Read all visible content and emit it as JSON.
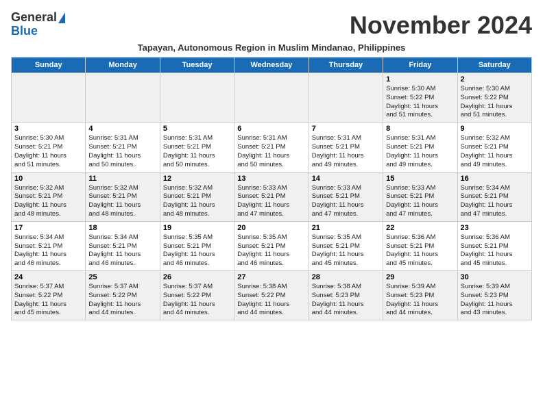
{
  "header": {
    "logo_general": "General",
    "logo_blue": "Blue",
    "month_title": "November 2024",
    "subtitle": "Tapayan, Autonomous Region in Muslim Mindanao, Philippines"
  },
  "weekdays": [
    "Sunday",
    "Monday",
    "Tuesday",
    "Wednesday",
    "Thursday",
    "Friday",
    "Saturday"
  ],
  "weeks": [
    [
      {
        "day": "",
        "info": ""
      },
      {
        "day": "",
        "info": ""
      },
      {
        "day": "",
        "info": ""
      },
      {
        "day": "",
        "info": ""
      },
      {
        "day": "",
        "info": ""
      },
      {
        "day": "1",
        "info": "Sunrise: 5:30 AM\nSunset: 5:22 PM\nDaylight: 11 hours\nand 51 minutes."
      },
      {
        "day": "2",
        "info": "Sunrise: 5:30 AM\nSunset: 5:22 PM\nDaylight: 11 hours\nand 51 minutes."
      }
    ],
    [
      {
        "day": "3",
        "info": "Sunrise: 5:30 AM\nSunset: 5:21 PM\nDaylight: 11 hours\nand 51 minutes."
      },
      {
        "day": "4",
        "info": "Sunrise: 5:31 AM\nSunset: 5:21 PM\nDaylight: 11 hours\nand 50 minutes."
      },
      {
        "day": "5",
        "info": "Sunrise: 5:31 AM\nSunset: 5:21 PM\nDaylight: 11 hours\nand 50 minutes."
      },
      {
        "day": "6",
        "info": "Sunrise: 5:31 AM\nSunset: 5:21 PM\nDaylight: 11 hours\nand 50 minutes."
      },
      {
        "day": "7",
        "info": "Sunrise: 5:31 AM\nSunset: 5:21 PM\nDaylight: 11 hours\nand 49 minutes."
      },
      {
        "day": "8",
        "info": "Sunrise: 5:31 AM\nSunset: 5:21 PM\nDaylight: 11 hours\nand 49 minutes."
      },
      {
        "day": "9",
        "info": "Sunrise: 5:32 AM\nSunset: 5:21 PM\nDaylight: 11 hours\nand 49 minutes."
      }
    ],
    [
      {
        "day": "10",
        "info": "Sunrise: 5:32 AM\nSunset: 5:21 PM\nDaylight: 11 hours\nand 48 minutes."
      },
      {
        "day": "11",
        "info": "Sunrise: 5:32 AM\nSunset: 5:21 PM\nDaylight: 11 hours\nand 48 minutes."
      },
      {
        "day": "12",
        "info": "Sunrise: 5:32 AM\nSunset: 5:21 PM\nDaylight: 11 hours\nand 48 minutes."
      },
      {
        "day": "13",
        "info": "Sunrise: 5:33 AM\nSunset: 5:21 PM\nDaylight: 11 hours\nand 47 minutes."
      },
      {
        "day": "14",
        "info": "Sunrise: 5:33 AM\nSunset: 5:21 PM\nDaylight: 11 hours\nand 47 minutes."
      },
      {
        "day": "15",
        "info": "Sunrise: 5:33 AM\nSunset: 5:21 PM\nDaylight: 11 hours\nand 47 minutes."
      },
      {
        "day": "16",
        "info": "Sunrise: 5:34 AM\nSunset: 5:21 PM\nDaylight: 11 hours\nand 47 minutes."
      }
    ],
    [
      {
        "day": "17",
        "info": "Sunrise: 5:34 AM\nSunset: 5:21 PM\nDaylight: 11 hours\nand 46 minutes."
      },
      {
        "day": "18",
        "info": "Sunrise: 5:34 AM\nSunset: 5:21 PM\nDaylight: 11 hours\nand 46 minutes."
      },
      {
        "day": "19",
        "info": "Sunrise: 5:35 AM\nSunset: 5:21 PM\nDaylight: 11 hours\nand 46 minutes."
      },
      {
        "day": "20",
        "info": "Sunrise: 5:35 AM\nSunset: 5:21 PM\nDaylight: 11 hours\nand 46 minutes."
      },
      {
        "day": "21",
        "info": "Sunrise: 5:35 AM\nSunset: 5:21 PM\nDaylight: 11 hours\nand 45 minutes."
      },
      {
        "day": "22",
        "info": "Sunrise: 5:36 AM\nSunset: 5:21 PM\nDaylight: 11 hours\nand 45 minutes."
      },
      {
        "day": "23",
        "info": "Sunrise: 5:36 AM\nSunset: 5:21 PM\nDaylight: 11 hours\nand 45 minutes."
      }
    ],
    [
      {
        "day": "24",
        "info": "Sunrise: 5:37 AM\nSunset: 5:22 PM\nDaylight: 11 hours\nand 45 minutes."
      },
      {
        "day": "25",
        "info": "Sunrise: 5:37 AM\nSunset: 5:22 PM\nDaylight: 11 hours\nand 44 minutes."
      },
      {
        "day": "26",
        "info": "Sunrise: 5:37 AM\nSunset: 5:22 PM\nDaylight: 11 hours\nand 44 minutes."
      },
      {
        "day": "27",
        "info": "Sunrise: 5:38 AM\nSunset: 5:22 PM\nDaylight: 11 hours\nand 44 minutes."
      },
      {
        "day": "28",
        "info": "Sunrise: 5:38 AM\nSunset: 5:23 PM\nDaylight: 11 hours\nand 44 minutes."
      },
      {
        "day": "29",
        "info": "Sunrise: 5:39 AM\nSunset: 5:23 PM\nDaylight: 11 hours\nand 44 minutes."
      },
      {
        "day": "30",
        "info": "Sunrise: 5:39 AM\nSunset: 5:23 PM\nDaylight: 11 hours\nand 43 minutes."
      }
    ]
  ]
}
